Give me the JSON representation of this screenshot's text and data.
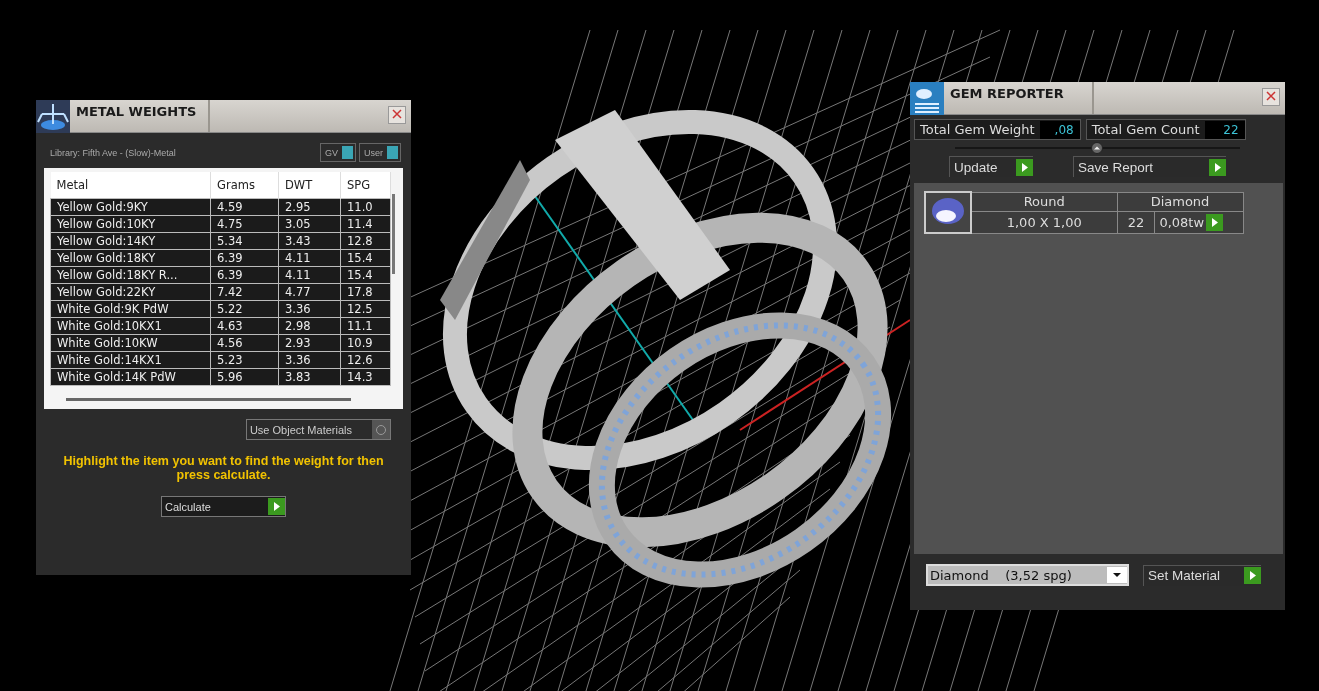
{
  "metal_weights": {
    "title": "METAL WEIGHTS",
    "library": "Library: Fifth Ave - (Slow)-Metal",
    "toggles": [
      {
        "label": "GV",
        "on": true
      },
      {
        "label": "User",
        "on": true
      }
    ],
    "table": {
      "columns": [
        "Metal",
        "Grams",
        "DWT",
        "SPG"
      ],
      "rows": [
        [
          "Yellow Gold:9KY",
          "4.59",
          "2.95",
          "11.0"
        ],
        [
          "Yellow Gold:10KY",
          "4.75",
          "3.05",
          "11.4"
        ],
        [
          "Yellow Gold:14KY",
          "5.34",
          "3.43",
          "12.8"
        ],
        [
          "Yellow Gold:18KY",
          "6.39",
          "4.11",
          "15.4"
        ],
        [
          "Yellow Gold:18KY R...",
          "6.39",
          "4.11",
          "15.4"
        ],
        [
          "Yellow Gold:22KY",
          "7.42",
          "4.77",
          "17.8"
        ],
        [
          "White Gold:9K PdW",
          "5.22",
          "3.36",
          "12.5"
        ],
        [
          "White Gold:10KX1",
          "4.63",
          "2.98",
          "11.1"
        ],
        [
          "White Gold:10KW",
          "4.56",
          "2.93",
          "10.9"
        ],
        [
          "White Gold:14KX1",
          "5.23",
          "3.36",
          "12.6"
        ],
        [
          "White Gold:14K PdW",
          "5.96",
          "3.83",
          "14.3"
        ]
      ]
    },
    "use_object_materials": {
      "label": "Use Object Materials",
      "checked": false
    },
    "hint": "Highlight the item you want to find the weight for then press calculate.",
    "calculate_button": "Calculate"
  },
  "gem_reporter": {
    "title": "GEM REPORTER",
    "total_gem_weight": {
      "label": "Total Gem Weight",
      "value": ",08"
    },
    "total_gem_count": {
      "label": "Total Gem Count",
      "value": "22"
    },
    "buttons": [
      "Update",
      "Save Report"
    ],
    "gems": [
      {
        "shape": "Round",
        "material": "Diamond",
        "size": "1,00 X 1,00",
        "count": "22",
        "weight": "0,08tw"
      }
    ],
    "material_select": {
      "value": "Diamond    (3,52 spg)"
    },
    "set_material_button": "Set Material"
  }
}
